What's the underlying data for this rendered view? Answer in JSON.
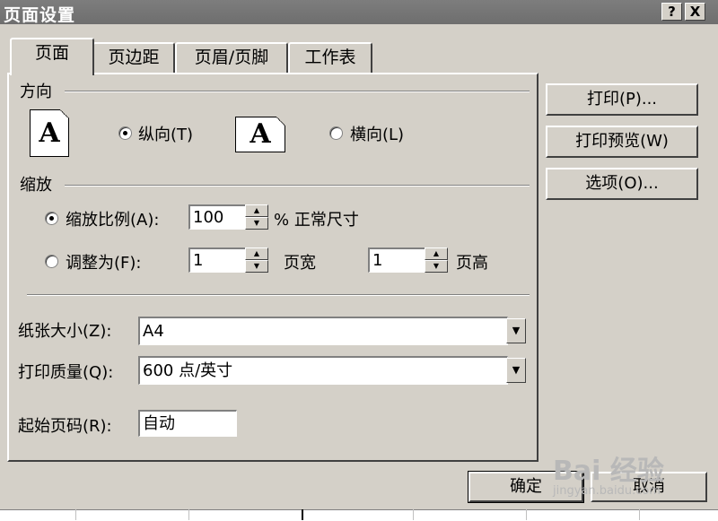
{
  "window": {
    "title": "页面设置",
    "help_label": "?",
    "close_label": "X"
  },
  "tabs": [
    "页面",
    "页边距",
    "页眉/页脚",
    "工作表"
  ],
  "orientation": {
    "group_label": "方向",
    "portrait_label": "纵向(T)",
    "landscape_label": "横向(L)",
    "icon_letter": "A"
  },
  "scaling": {
    "group_label": "缩放",
    "adjust_to_label": "缩放比例(A):",
    "adjust_value": "100",
    "percent_suffix": "% 正常尺寸",
    "fit_to_label": "调整为(F):",
    "pages_wide_value": "1",
    "pages_wide_label": "页宽",
    "pages_tall_value": "1",
    "pages_tall_label": "页高"
  },
  "paper": {
    "label": "纸张大小(Z):",
    "value": "A4"
  },
  "quality": {
    "label": "打印质量(Q):",
    "value": "600 点/英寸"
  },
  "first_page": {
    "label": "起始页码(R):",
    "value": "自动"
  },
  "side_buttons": {
    "print": "打印(P)...",
    "preview": "打印预览(W)",
    "options": "选项(O)..."
  },
  "footer_buttons": {
    "ok": "确定",
    "cancel": "取消"
  },
  "watermark": {
    "brand": "Bai 经验",
    "url": "jingyan.baidu.com"
  }
}
